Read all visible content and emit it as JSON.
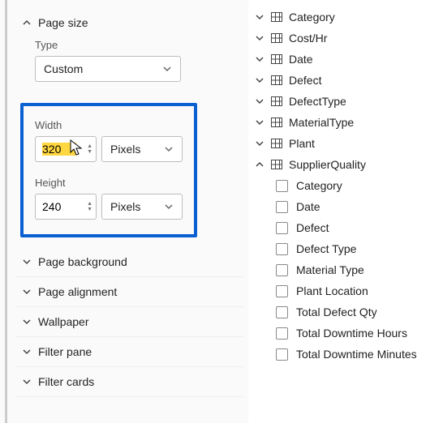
{
  "left_panel": {
    "page_size": {
      "header": "Page size",
      "type_label": "Type",
      "type_value": "Custom",
      "width_label": "Width",
      "width_value": "320",
      "width_unit": "Pixels",
      "height_label": "Height",
      "height_value": "240",
      "height_unit": "Pixels"
    },
    "sections": [
      {
        "label": "Page background"
      },
      {
        "label": "Page alignment"
      },
      {
        "label": "Wallpaper"
      },
      {
        "label": "Filter pane"
      },
      {
        "label": "Filter cards"
      }
    ]
  },
  "right_panel": {
    "tables": [
      {
        "label": "Category",
        "expanded": false
      },
      {
        "label": "Cost/Hr",
        "expanded": false
      },
      {
        "label": "Date",
        "expanded": false
      },
      {
        "label": "Defect",
        "expanded": false
      },
      {
        "label": "DefectType",
        "expanded": false
      },
      {
        "label": "MaterialType",
        "expanded": false
      },
      {
        "label": "Plant",
        "expanded": false
      },
      {
        "label": "SupplierQuality",
        "expanded": true
      }
    ],
    "supplier_fields": [
      {
        "label": "Category"
      },
      {
        "label": "Date"
      },
      {
        "label": "Defect"
      },
      {
        "label": "Defect Type"
      },
      {
        "label": "Material Type"
      },
      {
        "label": "Plant Location"
      },
      {
        "label": "Total Defect Qty"
      },
      {
        "label": "Total Downtime Hours"
      },
      {
        "label": "Total Downtime Minutes"
      }
    ]
  }
}
